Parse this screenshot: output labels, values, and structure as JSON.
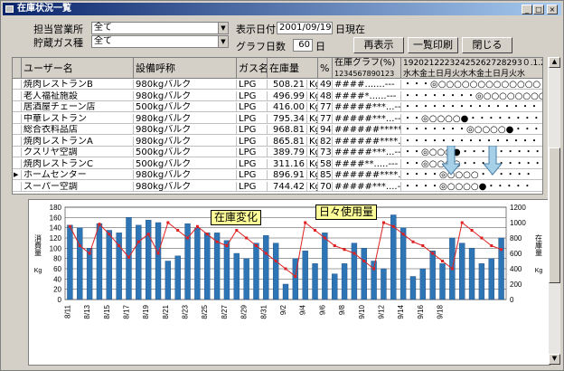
{
  "window": {
    "title": "在庫状況一覧",
    "btn_min": "_",
    "btn_max": "□",
    "btn_close": "×"
  },
  "filters": {
    "sales_label": "担当営業所",
    "sales_value": "全て",
    "gas_label": "貯蔵ガス種",
    "gas_value": "全て",
    "date_label": "表示日付",
    "date_value": "2001/09/19",
    "date_suffix": "日現在",
    "days_label": "グラフ日数",
    "days_value": "60",
    "days_suffix": "日"
  },
  "buttons": {
    "redisplay": "再表示",
    "print": "一覧印刷",
    "close": "閉じる"
  },
  "table": {
    "headers": {
      "user": "ユーザー名",
      "equipment": "設備呼称",
      "gas": "ガス名",
      "stock": "在庫量",
      "pct": "%",
      "graph": "在庫グラフ(%)",
      "graph_scale": "1234567890123",
      "dates": "19202122232425262728293０.1.2.3",
      "weekdays": "水木金土日月火水木金土日月火水"
    },
    "rows": [
      {
        "user": "焼肉レストランB",
        "equipment": "980kgバルク",
        "gas": "LPG",
        "stock": "508.21",
        "unit": "Kg",
        "pct": "49",
        "bar": "####.......---",
        "days": "・・・◎○○○○○○○○○○○○○"
      },
      {
        "user": "老人福祉施設",
        "equipment": "980kgバルク",
        "gas": "LPG",
        "stock": "496.99",
        "unit": "Kg",
        "pct": "48",
        "bar": "####*......---",
        "days": "・・・・・・・・◎○○○○○○○○"
      },
      {
        "user": "居酒屋チェーン店",
        "equipment": "500kgバルク",
        "gas": "LPG",
        "stock": "416.00",
        "unit": "Kg",
        "pct": "77",
        "bar": "#####***...---",
        "days": "・・・・・・・・・・・・・・・"
      },
      {
        "user": "中華レストラン",
        "equipment": "980kgバルク",
        "gas": "LPG",
        "stock": "795.34",
        "unit": "Kg",
        "pct": "77",
        "bar": "#####***...---",
        "days": "・・◎○○○○●・・・・・・・・・"
      },
      {
        "user": "総合衣料品店",
        "equipment": "980kgバルク",
        "gas": "LPG",
        "stock": "968.81",
        "unit": "Kg",
        "pct": "94",
        "bar": "######*****..-",
        "days": "・・・・・・・◎○○○○●・・・・"
      },
      {
        "user": "焼肉レストランA",
        "equipment": "980kgバルク",
        "gas": "LPG",
        "stock": "865.81",
        "unit": "Kg",
        "pct": "82",
        "bar": "######****..--",
        "days": "・・・・・・・・・・・・・・・"
      },
      {
        "user": "クスリヤ空調",
        "equipment": "500kgバルク",
        "gas": "LPG",
        "stock": "389.79",
        "unit": "Kg",
        "pct": "73",
        "bar": "#####***...---",
        "days": "・・◎○○○●・・・・・・・・・"
      },
      {
        "user": "焼肉レストランC",
        "equipment": "500kgバルク",
        "gas": "LPG",
        "stock": "311.16",
        "unit": "Kg",
        "pct": "58",
        "bar": "####**.....---",
        "days": "・・◎○○○○・・・・・・・・・"
      },
      {
        "user": "ホームセンター",
        "equipment": "980kgバルク",
        "gas": "LPG",
        "stock": "896.91",
        "unit": "Kg",
        "pct": "85",
        "bar": "######****..--",
        "days": "・・・・◎○○○○・・・・・・"
      },
      {
        "user": "スーパー空調",
        "equipment": "980kgバルク",
        "gas": "LPG",
        "stock": "744.42",
        "unit": "Kg",
        "pct": "70",
        "bar": "#####***....--",
        "days": "・・・・◎○○○○●・・・・・"
      }
    ]
  },
  "annotations": {
    "stock_change": "在庫変化",
    "daily_usage": "日々使用量"
  },
  "colors": {
    "bar": "#2e75b6",
    "line": "#e02020",
    "title_start": "#0a246a",
    "title_end": "#a6caf0",
    "callout": "#ffff99",
    "arrow": "#a6cfe8"
  },
  "chart_data": {
    "type": "bar",
    "ylabel": "消費量 Kg",
    "y2label": "在庫量 Kg",
    "ylim": [
      0,
      180
    ],
    "y2lim": [
      0,
      1200
    ],
    "yticks": [
      "0",
      "20",
      "40",
      "60",
      "80",
      "100",
      "120",
      "140",
      "160",
      "180"
    ],
    "y2ticks": [
      "0",
      "200",
      "400",
      "600",
      "800",
      "1000",
      "1200"
    ],
    "xtick_labels": [
      "8/11",
      "8/13",
      "8/15",
      "8/17",
      "8/19",
      "8/21",
      "8/23",
      "8/25",
      "8/27",
      "8/29",
      "8/31",
      "9/2",
      "9/4",
      "9/6",
      "9/8",
      "9/10",
      "9/12",
      "9/14",
      "9/16",
      "9/18"
    ],
    "series": [
      {
        "type": "bar",
        "values": [
          145,
          140,
          100,
          148,
          135,
          130,
          160,
          145,
          155,
          150,
          75,
          85,
          148,
          140,
          130,
          130,
          115,
          90,
          80,
          110,
          125,
          110,
          30,
          80,
          95,
          70,
          130,
          50,
          70,
          110,
          100,
          75,
          60,
          165,
          140,
          45,
          60,
          95,
          70,
          120,
          110,
          100,
          70,
          80,
          120
        ]
      },
      {
        "type": "line",
        "axis": "y2",
        "values": [
          950,
          700,
          600,
          980,
          850,
          700,
          550,
          750,
          850,
          600,
          1000,
          900,
          800,
          950,
          850,
          750,
          700,
          900,
          800,
          700,
          600,
          500,
          400,
          300,
          1000,
          900,
          800,
          700,
          650,
          600,
          500,
          400,
          1000,
          950,
          850,
          750,
          700,
          600,
          500,
          400,
          1000,
          900,
          800,
          700,
          650
        ]
      }
    ]
  }
}
